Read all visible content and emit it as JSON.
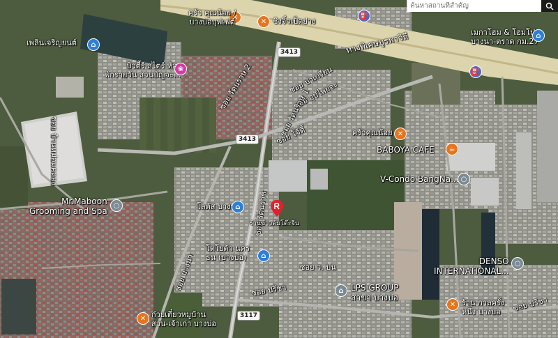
{
  "search": {
    "placeholder": "ค้นหาสถานที่สำคัญ"
  },
  "routes": {
    "r1": "3413",
    "r2": "3413",
    "r3": "3117"
  },
  "labels": {
    "highway": "ทางพิเศษบูรพาวิถี",
    "krua_khunnoi": "ครัว คุณน้อย /\nบางบ่อบุฟเฟต์",
    "ching_chiu": "ชิงจิ๋วเป็ดย่าง",
    "megahome": "เมกาโฮม & โฮมโปร\nบางนา-ตราด กม.27",
    "plern": "เพลินเจริญยนต์",
    "beauty": "บิวตี้ร์ สไตร์ ห้อง\nพักรายวัน สวนบัญจะ...",
    "soi_rattanarat2": "ซอย รัตนราษ 2",
    "soi_pakrian": "ซอย ป่าเกรียน",
    "soi_upaiyachan": "ซอย อุปไพยจะ",
    "soi_rattanarat1": "ซอย รัตนราษ 1",
    "soi_jode": "ซอย โจ้ดี้",
    "soi_bannomthumkhlong": "ซอย บ้านหม่อมคลอง",
    "krua_khunnoi2": "ครัวคุณน้อย",
    "baboya": "BABOYA CAFE",
    "vcondo": "V-Condo BangNa...",
    "mrmaboon": "Mr.Maboon\nGrooming and Spa",
    "lotus": "โลตัส บางบ่อ",
    "soi_rattanarach": "ซอย รัตนราช",
    "marker_label": "ร้านข้าวต้มโต๊ะจีน",
    "toyota": "โตโยต้า นคร\nธน (บางบ่อ)",
    "soi_bangna": "ซอย บางนา",
    "soi_wapon": "ซอย ว. ปน",
    "soi_pricha": "ซอย ปรีชา",
    "lps": "LPS GROUP\nสาขา บางบ่อ",
    "denso": "DENSO\nINTERNATIONAL...",
    "ruan_kuay": "ร้าน กาลครั้ง\nหนึ่ง บางบอ",
    "soi_pricha2": "ซอย ปรีชา",
    "kuaytiew": "ก๋วยเตี๋ยวหมูบ้าน\nสวน-เจ้าเก่า บางบ่อ"
  },
  "icons": {
    "food": "utensils-icon",
    "shop": "shopping-bag-icon",
    "gas": "gas-station-icon",
    "cafe": "coffee-cup-icon",
    "nail": "beauty-icon",
    "place": "place-icon",
    "marker": "selected-location-marker-icon",
    "search": "search-icon"
  }
}
